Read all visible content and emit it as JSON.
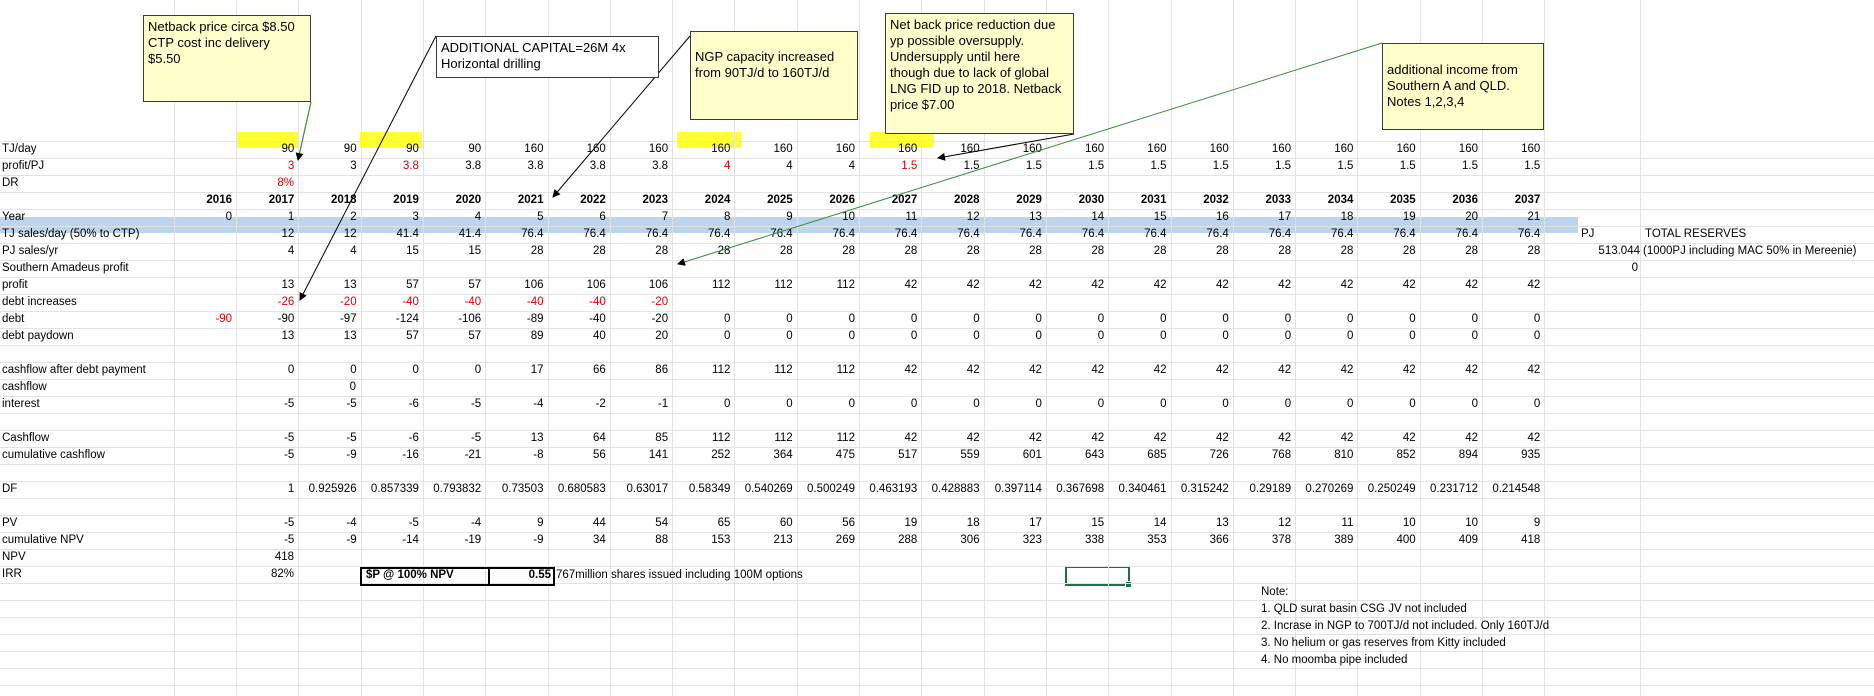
{
  "colors": {
    "highlight": "#ffff33",
    "band": "#bcd5ee",
    "negative": "#e00000",
    "note_bg": "#ffffcc",
    "selection": "#1e7145"
  },
  "notes": [
    {
      "lines": [
        "Netback price circa $8.50",
        "CTP cost inc delivery",
        "$5.50"
      ]
    },
    {
      "lines": [
        "ADDITIONAL CAPITAL=26M 4x",
        "Horizontal drilling"
      ]
    },
    {
      "lines": [
        "NGP capacity increased",
        "from 90TJ/d to 160TJ/d"
      ]
    },
    {
      "lines": [
        "Net back price reduction due",
        "yp possible oversupply.",
        "Undersupply until here",
        "though due to lack of global",
        "LNG FID up to 2018. Netback",
        "price $7.00"
      ]
    },
    {
      "lines": [
        "additional income from",
        "Southern A and QLD.",
        "Notes 1,2,3,4"
      ]
    }
  ],
  "labels": {
    "tj_day": "TJ/day",
    "profit_pj": "profit/PJ",
    "dr": "DR",
    "year": "Year",
    "tj_sales": "TJ sales/day (50% to CTP)",
    "pj_sales": "PJ sales/yr",
    "southern": "Southern Amadeus profit",
    "profit": "profit",
    "debt_increases": "debt increases",
    "debt": "debt",
    "debt_paydown": "debt paydown",
    "cashflow_after": "cashflow after debt payment",
    "cashflow": "cashflow",
    "interest": "interest",
    "cashflow2": "Cashflow",
    "cum_cashflow": "cumulative cashflow",
    "df": "DF",
    "pv": "PV",
    "cum_npv": "cumulative NPV",
    "npv": "NPV",
    "irr": "IRR"
  },
  "side": {
    "pj_unit": "PJ",
    "total_reserves_label": "TOTAL RESERVES",
    "reserves_value": "513.044",
    "reserves_note": "(1000PJ including MAC 50% in Mereenie)",
    "zero": "0"
  },
  "single": {
    "dr": "8%",
    "npv": "418",
    "irr": "82%",
    "year2016": "2016",
    "year0": "0",
    "debt_init": "-90",
    "cashflow_year2": "0"
  },
  "sp": {
    "label": "$P @ 100% NPV",
    "value": "0.55",
    "shares": "767million shares issued including 100M options"
  },
  "footnotes": [
    "Note:",
    "1. QLD surat basin CSG JV not included",
    "2. Incrase in NGP to 700TJ/d not included. Only 160TJ/d",
    "3. No helium or gas reserves from Kitty included",
    "4. No moomba pipe included"
  ],
  "rows": {
    "tjday": [
      "90",
      "90",
      "90",
      "90",
      "160",
      "160",
      "160",
      "160",
      "160",
      "160",
      "160",
      "160",
      "160",
      "160",
      "160",
      "160",
      "160",
      "160",
      "160",
      "160",
      "160"
    ],
    "profitpj": [
      "3",
      "3",
      "3.8",
      "3.8",
      "3.8",
      "3.8",
      "3.8",
      "4",
      "4",
      "4",
      "1.5",
      "1.5",
      "1.5",
      "1.5",
      "1.5",
      "1.5",
      "1.5",
      "1.5",
      "1.5",
      "1.5",
      "1.5"
    ],
    "years": [
      "2017",
      "2018",
      "2019",
      "2020",
      "2021",
      "2022",
      "2023",
      "2024",
      "2025",
      "2026",
      "2027",
      "2028",
      "2029",
      "2030",
      "2031",
      "2032",
      "2033",
      "2034",
      "2035",
      "2036",
      "2037"
    ],
    "yearnum": [
      "1",
      "2",
      "3",
      "4",
      "5",
      "6",
      "7",
      "8",
      "9",
      "10",
      "11",
      "12",
      "13",
      "14",
      "15",
      "16",
      "17",
      "18",
      "19",
      "20",
      "21"
    ],
    "tjsales": [
      "12",
      "12",
      "41.4",
      "41.4",
      "76.4",
      "76.4",
      "76.4",
      "76.4",
      "76.4",
      "76.4",
      "76.4",
      "76.4",
      "76.4",
      "76.4",
      "76.4",
      "76.4",
      "76.4",
      "76.4",
      "76.4",
      "76.4",
      "76.4"
    ],
    "pjsales": [
      "4",
      "4",
      "15",
      "15",
      "28",
      "28",
      "28",
      "28",
      "28",
      "28",
      "28",
      "28",
      "28",
      "28",
      "28",
      "28",
      "28",
      "28",
      "28",
      "28",
      "28"
    ],
    "profit": [
      "13",
      "13",
      "57",
      "57",
      "106",
      "106",
      "106",
      "112",
      "112",
      "112",
      "42",
      "42",
      "42",
      "42",
      "42",
      "42",
      "42",
      "42",
      "42",
      "42",
      "42"
    ],
    "debtinc": [
      "-26",
      "-20",
      "-40",
      "-40",
      "-40",
      "-40",
      "-20",
      "",
      "",
      "",
      "",
      "",
      "",
      "",
      "",
      "",
      "",
      "",
      "",
      "",
      ""
    ],
    "debt": [
      "-90",
      "-97",
      "-124",
      "-106",
      "-89",
      "-40",
      "-20",
      "0",
      "0",
      "0",
      "0",
      "0",
      "0",
      "0",
      "0",
      "0",
      "0",
      "0",
      "0",
      "0",
      "0"
    ],
    "paydown": [
      "13",
      "13",
      "57",
      "57",
      "89",
      "40",
      "20",
      "0",
      "0",
      "0",
      "0",
      "0",
      "0",
      "0",
      "0",
      "0",
      "0",
      "0",
      "0",
      "0",
      "0"
    ],
    "cfafter": [
      "0",
      "0",
      "0",
      "0",
      "17",
      "66",
      "86",
      "112",
      "112",
      "112",
      "42",
      "42",
      "42",
      "42",
      "42",
      "42",
      "42",
      "42",
      "42",
      "42",
      "42"
    ],
    "interest": [
      "-5",
      "-5",
      "-6",
      "-5",
      "-4",
      "-2",
      "-1",
      "0",
      "0",
      "0",
      "0",
      "0",
      "0",
      "0",
      "0",
      "0",
      "0",
      "0",
      "0",
      "0",
      "0"
    ],
    "cashflow": [
      "-5",
      "-5",
      "-6",
      "-5",
      "13",
      "64",
      "85",
      "112",
      "112",
      "112",
      "42",
      "42",
      "42",
      "42",
      "42",
      "42",
      "42",
      "42",
      "42",
      "42",
      "42"
    ],
    "cumcf": [
      "-5",
      "-9",
      "-16",
      "-21",
      "-8",
      "56",
      "141",
      "252",
      "364",
      "475",
      "517",
      "559",
      "601",
      "643",
      "685",
      "726",
      "768",
      "810",
      "852",
      "894",
      "935"
    ],
    "df": [
      "1",
      "0.925926",
      "0.857339",
      "0.793832",
      "0.73503",
      "0.680583",
      "0.63017",
      "0.58349",
      "0.540269",
      "0.500249",
      "0.463193",
      "0.428883",
      "0.397114",
      "0.367698",
      "0.340461",
      "0.315242",
      "0.29189",
      "0.270269",
      "0.250249",
      "0.231712",
      "0.214548"
    ],
    "pv": [
      "-5",
      "-4",
      "-5",
      "-4",
      "9",
      "44",
      "54",
      "65",
      "60",
      "56",
      "19",
      "18",
      "17",
      "15",
      "14",
      "13",
      "12",
      "11",
      "10",
      "10",
      "9"
    ],
    "cumnpv": [
      "-5",
      "-9",
      "-14",
      "-19",
      "-9",
      "34",
      "88",
      "153",
      "213",
      "269",
      "288",
      "306",
      "323",
      "338",
      "353",
      "366",
      "378",
      "389",
      "400",
      "409",
      "418"
    ]
  }
}
